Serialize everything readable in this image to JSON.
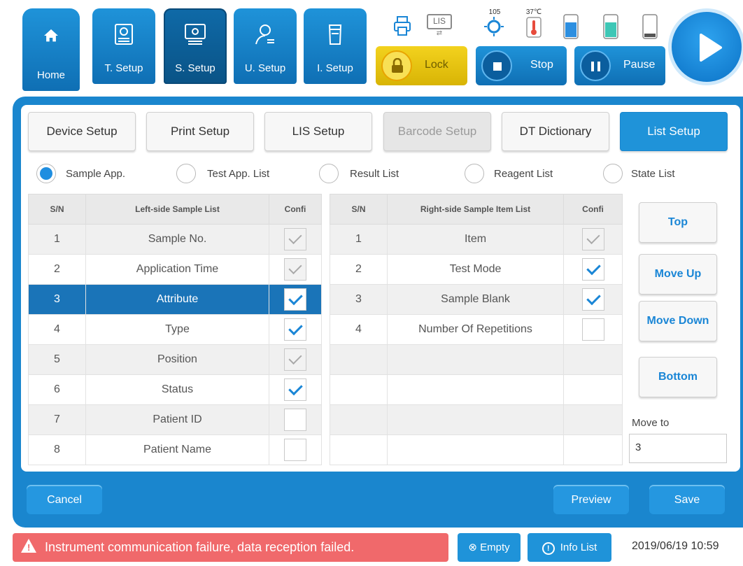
{
  "toolbar": {
    "home_label": "Home",
    "t_setup_label": "T. Setup",
    "s_setup_label": "S. Setup",
    "u_setup_label": "U. Setup",
    "i_setup_label": "I. Setup",
    "lock_label": "Lock",
    "stop_label": "Stop",
    "pause_label": "Pause",
    "lis_icon_text": "LIS",
    "counter_value": "105",
    "temperature": "37℃"
  },
  "tabs": {
    "device": "Device Setup",
    "print": "Print Setup",
    "lis": "LIS Setup",
    "barcode": "Barcode Setup",
    "dictionary": "DT Dictionary",
    "list": "List Setup"
  },
  "radios": {
    "sample_app": "Sample App.",
    "test_app_list": "Test App. List",
    "result_list": "Result List",
    "reagent_list": "Reagent List",
    "state_list": "State List"
  },
  "left_table": {
    "headers": {
      "sn": "S/N",
      "name": "Left-side Sample List",
      "confi": "Confi"
    },
    "rows": [
      {
        "sn": "1",
        "name": "Sample No."
      },
      {
        "sn": "2",
        "name": "Application Time"
      },
      {
        "sn": "3",
        "name": "Attribute"
      },
      {
        "sn": "4",
        "name": "Type"
      },
      {
        "sn": "5",
        "name": "Position"
      },
      {
        "sn": "6",
        "name": "Status"
      },
      {
        "sn": "7",
        "name": "Patient ID"
      },
      {
        "sn": "8",
        "name": "Patient Name"
      }
    ]
  },
  "right_table": {
    "headers": {
      "sn": "S/N",
      "name": "Right-side Sample Item List",
      "confi": "Confi"
    },
    "rows": [
      {
        "sn": "1",
        "name": "Item"
      },
      {
        "sn": "2",
        "name": "Test Mode"
      },
      {
        "sn": "3",
        "name": "Sample Blank"
      },
      {
        "sn": "4",
        "name": "Number Of Repetitions"
      }
    ]
  },
  "side_buttons": {
    "top": "Top",
    "move_up": "Move Up",
    "move_down": "Move Down",
    "bottom": "Bottom",
    "move_to_label": "Move to",
    "move_to_value": "3"
  },
  "actions": {
    "cancel": "Cancel",
    "preview": "Preview",
    "save": "Save"
  },
  "status": {
    "alert": "Instrument communication failure, data reception failed.",
    "empty": "Empty",
    "info_list": "Info List",
    "datetime": "2019/06/19 10:59"
  },
  "colors": {
    "primary": "#1f93d9",
    "panel": "#1a86ce",
    "alert": "#f0696b",
    "lock": "#f3d21e",
    "selected_row": "#1a74b8"
  },
  "icons": {
    "home": "home-icon",
    "t_setup": "tray-settings-icon",
    "s_setup": "gear-screen-icon",
    "u_setup": "user-icon",
    "i_setup": "cup-icon",
    "printer": "printer-icon",
    "lis": "lis-icon",
    "lock": "padlock-icon",
    "thermometer": "thermometer-icon",
    "play": "play-icon"
  }
}
